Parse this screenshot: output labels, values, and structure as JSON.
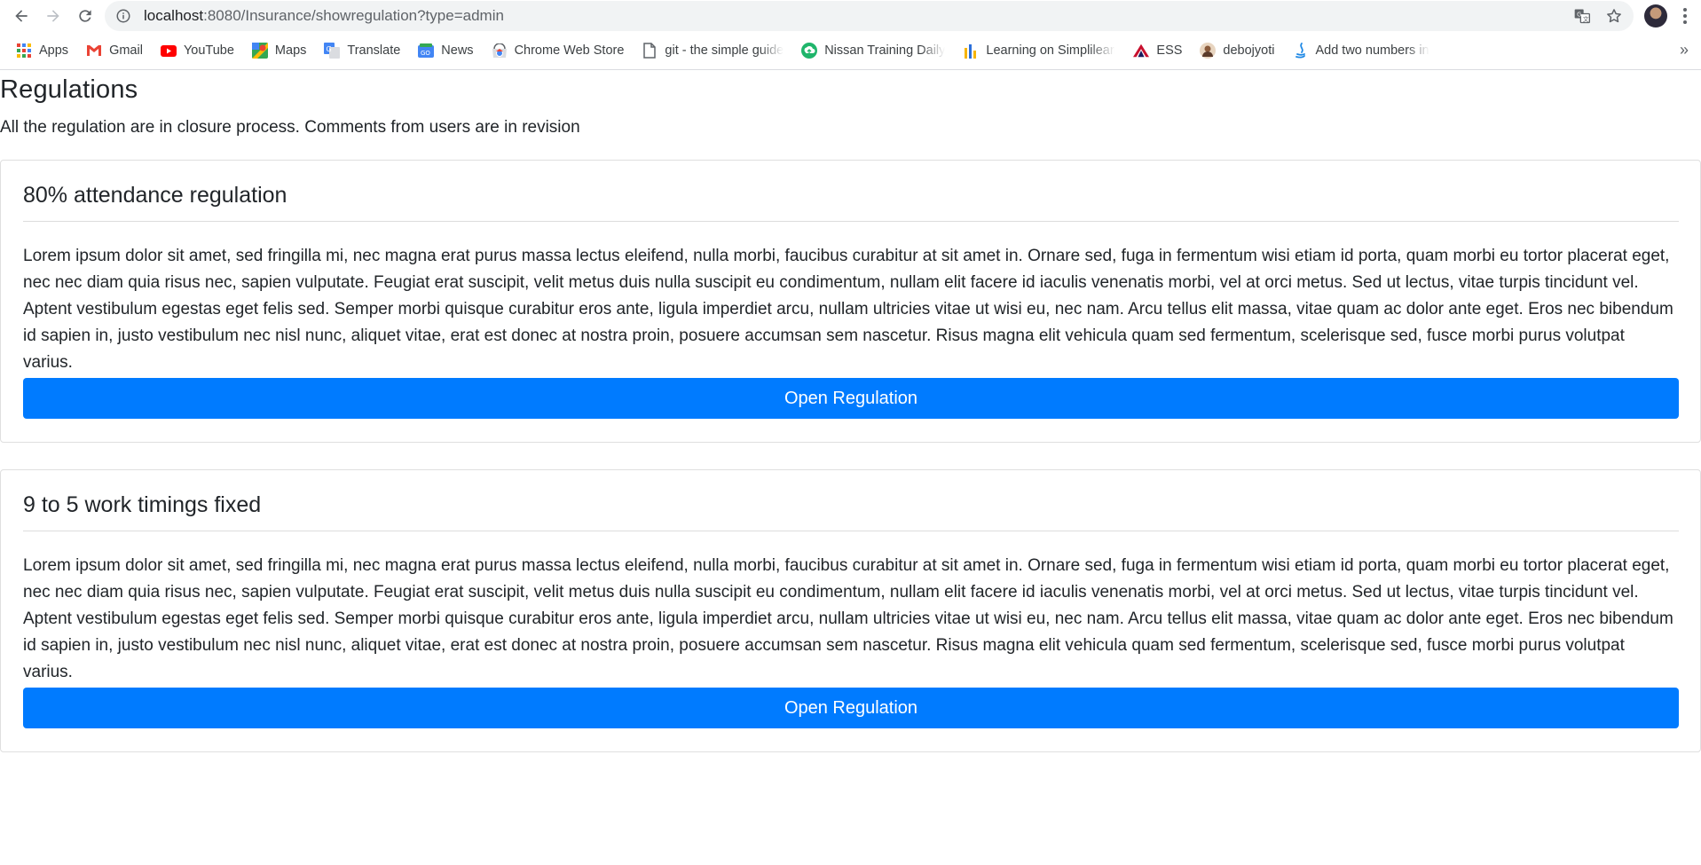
{
  "browser": {
    "url_host": "localhost",
    "url_rest": ":8080/Insurance/showregulation?type=admin",
    "bookmarks": [
      {
        "label": "Apps",
        "icon": "apps-grid-icon"
      },
      {
        "label": "Gmail",
        "icon": "gmail-icon"
      },
      {
        "label": "YouTube",
        "icon": "youtube-icon"
      },
      {
        "label": "Maps",
        "icon": "maps-icon"
      },
      {
        "label": "Translate",
        "icon": "translate-icon"
      },
      {
        "label": "News",
        "icon": "news-icon"
      },
      {
        "label": "Chrome Web Store",
        "icon": "web-store-icon"
      },
      {
        "label": "git - the simple guide",
        "icon": "page-icon"
      },
      {
        "label": "Nissan Training Daily",
        "icon": "cloud-upload-icon"
      },
      {
        "label": "Learning on Simplilearn",
        "icon": "simplilearn-icon"
      },
      {
        "label": "ESS",
        "icon": "ess-icon"
      },
      {
        "label": "debojyoti",
        "icon": "user-avatar-icon"
      },
      {
        "label": "Add two numbers in",
        "icon": "java-icon"
      }
    ],
    "more_label": "»"
  },
  "page": {
    "title": "Regulations",
    "subtitle": "All the regulation are in closure process. Comments from users are in revision"
  },
  "regulations": [
    {
      "title": "80% attendance regulation",
      "body": "Lorem ipsum dolor sit amet, sed fringilla mi, nec magna erat purus massa lectus eleifend, nulla morbi, faucibus curabitur at sit amet in. Ornare sed, fuga in fermentum wisi etiam id porta, quam morbi eu tortor placerat eget, nec nec diam quia risus nec, sapien vulputate. Feugiat erat suscipit, velit metus duis nulla suscipit eu condimentum, nullam elit facere id iaculis venenatis morbi, vel at orci metus. Sed ut lectus, vitae turpis tincidunt vel. Aptent vestibulum egestas eget felis sed. Semper morbi quisque curabitur eros ante, ligula imperdiet arcu, nullam ultricies vitae ut wisi eu, nec nam. Arcu tellus elit massa, vitae quam ac dolor ante eget. Eros nec bibendum id sapien in, justo vestibulum nec nisl nunc, aliquet vitae, erat est donec at nostra proin, posuere accumsan sem nascetur. Risus magna elit vehicula quam sed fermentum, scelerisque sed, fusce morbi purus volutpat varius.",
      "button": "Open Regulation"
    },
    {
      "title": "9 to 5 work timings fixed",
      "body": "Lorem ipsum dolor sit amet, sed fringilla mi, nec magna erat purus massa lectus eleifend, nulla morbi, faucibus curabitur at sit amet in. Ornare sed, fuga in fermentum wisi etiam id porta, quam morbi eu tortor placerat eget, nec nec diam quia risus nec, sapien vulputate. Feugiat erat suscipit, velit metus duis nulla suscipit eu condimentum, nullam elit facere id iaculis venenatis morbi, vel at orci metus. Sed ut lectus, vitae turpis tincidunt vel. Aptent vestibulum egestas eget felis sed. Semper morbi quisque curabitur eros ante, ligula imperdiet arcu, nullam ultricies vitae ut wisi eu, nec nam. Arcu tellus elit massa, vitae quam ac dolor ante eget. Eros nec bibendum id sapien in, justo vestibulum nec nisl nunc, aliquet vitae, erat est donec at nostra proin, posuere accumsan sem nascetur. Risus magna elit vehicula quam sed fermentum, scelerisque sed, fusce morbi purus volutpat varius.",
      "button": "Open Regulation"
    }
  ],
  "colors": {
    "primary_button": "#007bff",
    "card_border": "#dfdfdf"
  }
}
